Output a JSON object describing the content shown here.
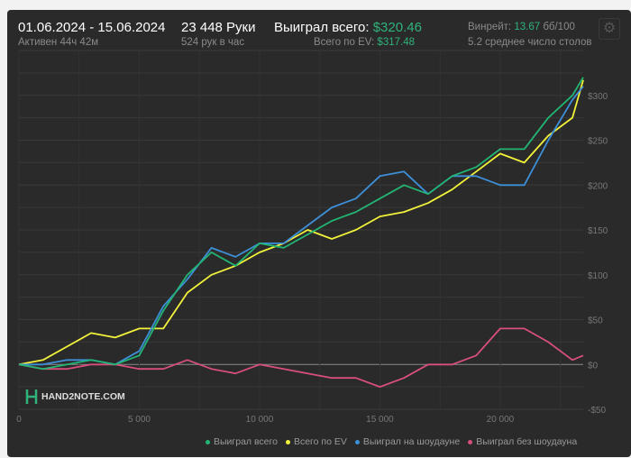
{
  "header": {
    "date_range": "01.06.2024 - 15.06.2024",
    "active": "Активен 44ч 42м",
    "hands": "23 448 Руки",
    "hands_per_hour": "524 рук в час",
    "won_total_label": "Выиграл всего:",
    "won_total_value": "$320.46",
    "ev_label": "Всего по EV:",
    "ev_value": "$317.48",
    "winrate_label": "Винрейт:",
    "winrate_value": "13.67",
    "winrate_unit": "бб/100",
    "avg_tables": "5.2 среднее число столов",
    "settings_icon": "gear-icon"
  },
  "watermark": "HAND2NOTE.COM",
  "colors": {
    "won_total": "#22b573",
    "ev": "#f2f23a",
    "showdown": "#3d8fd8",
    "non_showdown": "#d94f7c",
    "accent": "#2fb37b"
  },
  "chart_data": {
    "type": "line",
    "xlim": [
      0,
      23448
    ],
    "ylim": [
      -50,
      350
    ],
    "x_ticks": [
      "0",
      "5 000",
      "10 000",
      "15 000",
      "20 000"
    ],
    "x_tick_values": [
      0,
      5000,
      10000,
      15000,
      20000
    ],
    "y_ticks": [
      "-$50",
      "$0",
      "$50",
      "$100",
      "$150",
      "$200",
      "$250",
      "$300"
    ],
    "y_tick_values": [
      -50,
      0,
      50,
      100,
      150,
      200,
      250,
      300
    ],
    "grid": true,
    "legend_position": "bottom-right",
    "x": [
      0,
      1000,
      2000,
      3000,
      4000,
      5000,
      6000,
      7000,
      8000,
      9000,
      10000,
      11000,
      12000,
      13000,
      14000,
      15000,
      16000,
      17000,
      18000,
      19000,
      20000,
      21000,
      22000,
      23000,
      23448
    ],
    "series": [
      {
        "name": "Выиграл всего",
        "color": "#22b573",
        "values": [
          0,
          -5,
          0,
          5,
          0,
          10,
          60,
          100,
          125,
          110,
          135,
          130,
          145,
          160,
          170,
          185,
          200,
          190,
          210,
          220,
          240,
          240,
          275,
          300,
          320
        ]
      },
      {
        "name": "Всего по EV",
        "color": "#f2f23a",
        "values": [
          0,
          5,
          20,
          35,
          30,
          40,
          40,
          80,
          100,
          110,
          125,
          135,
          150,
          140,
          150,
          165,
          170,
          180,
          195,
          215,
          235,
          225,
          255,
          275,
          317
        ]
      },
      {
        "name": "Выиграл на шоудауне",
        "color": "#3d8fd8",
        "values": [
          0,
          0,
          5,
          5,
          0,
          15,
          65,
          95,
          130,
          120,
          135,
          135,
          155,
          175,
          185,
          210,
          215,
          190,
          210,
          210,
          200,
          200,
          250,
          295,
          310
        ]
      },
      {
        "name": "Выиграл без шоудауна",
        "color": "#d94f7c",
        "values": [
          0,
          -5,
          -5,
          0,
          0,
          -5,
          -5,
          5,
          -5,
          -10,
          0,
          -5,
          -10,
          -15,
          -15,
          -25,
          -15,
          0,
          0,
          10,
          40,
          40,
          25,
          5,
          10
        ]
      }
    ]
  }
}
